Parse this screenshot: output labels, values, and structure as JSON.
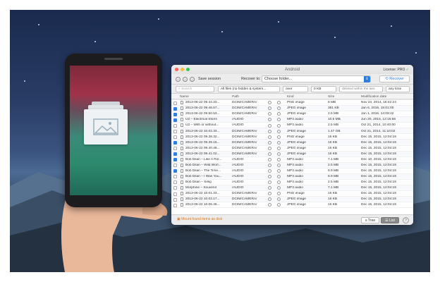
{
  "window": {
    "title": "Android",
    "license_label": "License: PRO",
    "license_check": "✓"
  },
  "toolbar": {
    "save_session": "Save session",
    "recover_to": "Recover to:",
    "folder_placeholder": "Choose folder...",
    "recover_button": "Recover"
  },
  "filters": {
    "search_placeholder": "Search",
    "file_filter": "All files (no hidden & system...",
    "size_compare": "over",
    "size_value": "0 KB",
    "deleted_within": "deleted within the last",
    "time_range": "any time"
  },
  "columns": {
    "name": "Name",
    "path": "Path",
    "kind": "Kind",
    "size": "Size",
    "date": "Modification date"
  },
  "rows": [
    {
      "name": "2013-06-22 09.44.33...",
      "path": "DCIM/CAMERA/",
      "kind": "PNG image",
      "size": "8 MB",
      "date": "Nov 24, 2014, 16:42:24",
      "checked": false
    },
    {
      "name": "2013-06-22 09.46.57...",
      "path": "DCIM/CAMERA/",
      "kind": "JPEG image",
      "size": "361 KB",
      "date": "Jan 6, 2016, 15:01:00",
      "checked": true
    },
    {
      "name": "2013-06-22 09.50.53...",
      "path": "DCIM/CAMERA/",
      "kind": "JPEG image",
      "size": "2.5 MB",
      "date": "Jan 1, 2016, 14:08:42",
      "checked": true
    },
    {
      "name": "U2 – Electrical Storm",
      "path": "/AUDIO",
      "kind": "MP3 audio",
      "size": "10.5 MB",
      "date": "Jun 20, 2016, 12:15:56",
      "checked": true
    },
    {
      "name": "U2 – With or without...",
      "path": "/AUDIO",
      "kind": "MP3 audio",
      "size": "2.5 MB",
      "date": "Oct 21, 2014, 10:40:00",
      "checked": false
    },
    {
      "name": "2013-06-22 10.02.33...",
      "path": "DCIM/CAMERA/",
      "kind": "JPEG image",
      "size": "1.47 GB",
      "date": "Oct 21, 2014, 11:10:02",
      "checked": false
    },
    {
      "name": "2013-06-22 09.38.32...",
      "path": "DCIM/CAMERA/",
      "kind": "PNG image",
      "size": "16 KB",
      "date": "Dec 15, 2015, 12:04:18",
      "checked": false
    },
    {
      "name": "2013-06-22 09.39.15...",
      "path": "DCIM/CAMERA/",
      "kind": "JPEG image",
      "size": "16 KB",
      "date": "Dec 15, 2015, 12:04:18",
      "checked": true
    },
    {
      "name": "2013-06-22 09.40.46...",
      "path": "DCIM/CAMERA/",
      "kind": "JPEG image",
      "size": "16 KB",
      "date": "Dec 15, 2015, 12:04:18",
      "checked": false
    },
    {
      "name": "2013-06-22 09.41.02...",
      "path": "DCIM/CAMERA/",
      "kind": "JPEG image",
      "size": "16 KB",
      "date": "Dec 15, 2015, 12:04:18",
      "checked": true
    },
    {
      "name": "Bob Dilan – Like A Rol...",
      "path": "/AUDIO",
      "kind": "MP3 audio",
      "size": "7.1 MB",
      "date": "Dec 10, 2015, 12:04:18",
      "checked": true
    },
    {
      "name": "Bob Dilan – Wild Worl...",
      "path": "/AUDIO",
      "kind": "MP3 audio",
      "size": "2.5 MB",
      "date": "Dec 15, 2015, 12:04:18",
      "checked": false
    },
    {
      "name": "Bob Dilan – The Time...",
      "path": "/AUDIO",
      "kind": "MP3 audio",
      "size": "8.9 MB",
      "date": "Dec 15, 2015, 12:04:18",
      "checked": true
    },
    {
      "name": "Bob Dilan – I Was You...",
      "path": "/AUDIO",
      "kind": "MP3 audio",
      "size": "8.9 MB",
      "date": "Dec 15, 2015, 12:04:18",
      "checked": false
    },
    {
      "name": "Bob Dilan – Selig",
      "path": "/AUDIO",
      "kind": "MP3 audio",
      "size": "2.5 MB",
      "date": "Dec 15, 2015, 12:04:18",
      "checked": false
    },
    {
      "name": "Morphine – Souvenir",
      "path": "/AUDIO",
      "kind": "MP3 audio",
      "size": "7.1 MB",
      "date": "Dec 15, 2015, 12:04:18",
      "checked": false
    },
    {
      "name": "2013-06-22 10.01.33...",
      "path": "DCIM/CAMERA/",
      "kind": "PNG image",
      "size": "16 KB",
      "date": "Dec 15, 2015, 12:04:18",
      "checked": false
    },
    {
      "name": "2013-06-22 10.03.17...",
      "path": "DCIM/CAMERA/",
      "kind": "JPEG image",
      "size": "16 KB",
      "date": "Dec 15, 2015, 12:04:18",
      "checked": false
    },
    {
      "name": "2013-06-22 10.06.45...",
      "path": "DCIM/CAMERA/",
      "kind": "JPEG image",
      "size": "16 KB",
      "date": "Dec 15, 2015, 12:04:18",
      "checked": false
    }
  ],
  "bottom": {
    "mount_button": "Mount found items as disk",
    "tree_button": "Tree",
    "list_button": "List",
    "help_button": "?"
  },
  "colors": {
    "accent": "#2f7de1",
    "mount": "#e07a1f",
    "license_ok": "#2aa35a"
  }
}
